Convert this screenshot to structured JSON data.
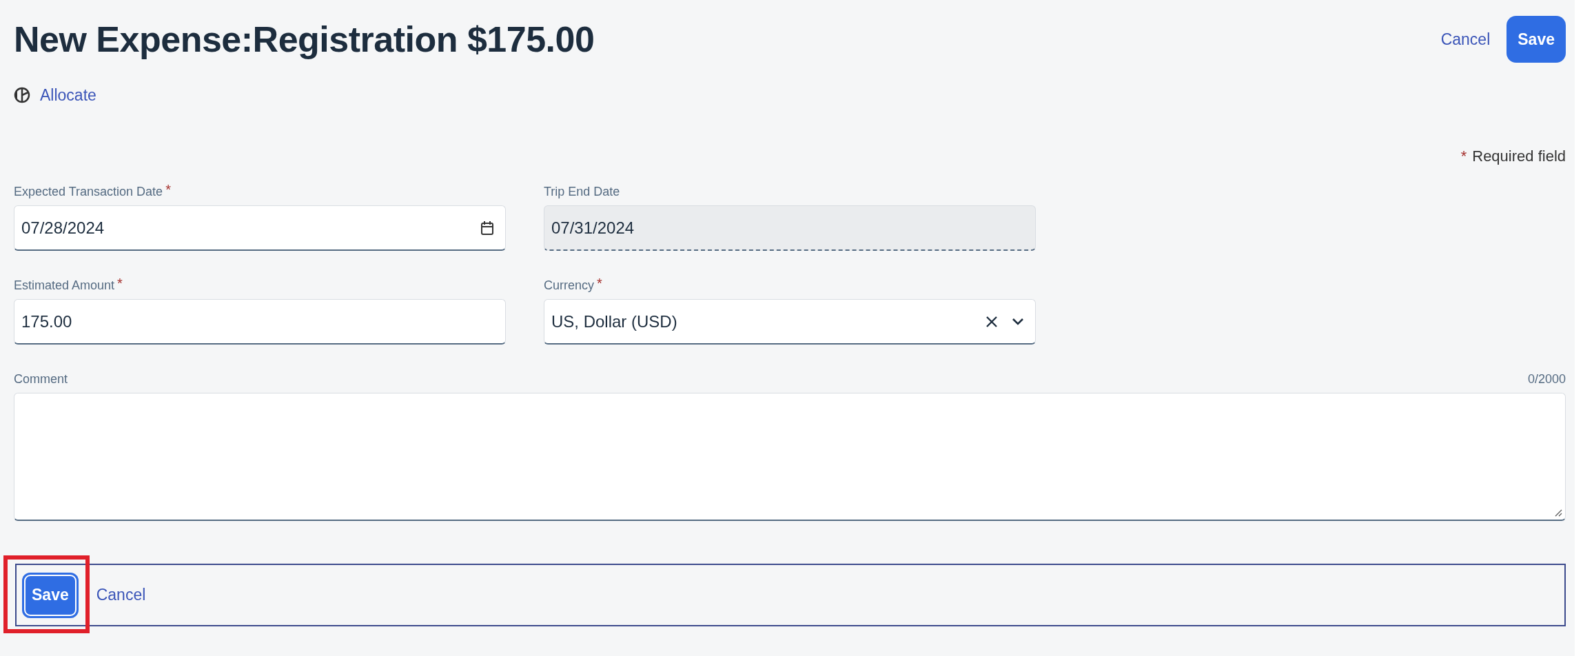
{
  "header": {
    "title": "New Expense:Registration $175.00",
    "cancel": "Cancel",
    "save": "Save"
  },
  "allocate": {
    "label": "Allocate"
  },
  "required_note": {
    "mark": "*",
    "label": "Required field"
  },
  "fields": [
    {
      "kind": "date",
      "label": "Expected Transaction Date",
      "required": true,
      "value": "07/28/2024",
      "disabled": false
    },
    {
      "kind": "text",
      "label": "Trip End Date",
      "required": false,
      "value": "07/31/2024",
      "disabled": true
    },
    {
      "kind": "text",
      "label": "Estimated Amount",
      "required": true,
      "value": "175.00",
      "disabled": false
    },
    {
      "kind": "select",
      "label": "Currency",
      "required": true,
      "value": "US, Dollar (USD)",
      "disabled": false
    }
  ],
  "comment": {
    "label": "Comment",
    "counter": "0/2000"
  },
  "footer": {
    "save": "Save",
    "cancel": "Cancel",
    "focused": true,
    "highlighted": true
  }
}
